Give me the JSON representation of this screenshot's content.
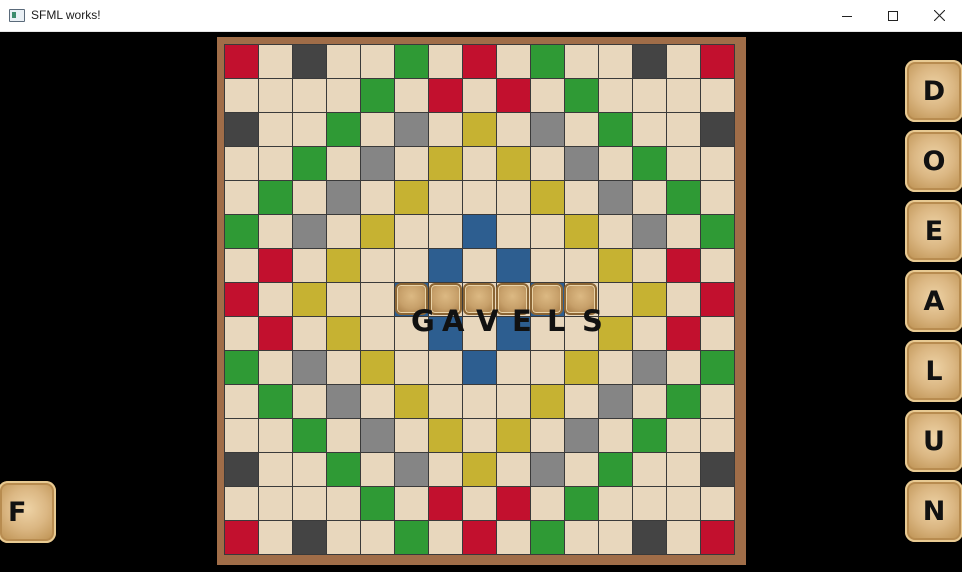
{
  "window": {
    "title": "SFML works!",
    "buttons": [
      "minimize",
      "maximize",
      "close"
    ]
  },
  "board": {
    "size": 15,
    "colors": {
      "normal": "#e8d7bd",
      "red": "#c2102e",
      "green": "#2f9a35",
      "yellow": "#c6b232",
      "gray": "#858585",
      "dark": "#444444",
      "blue": "#2d5e90",
      "frame": "#a06d48"
    },
    "layout": [
      "r..d..g.r.g..d.r",
      ".....g.r.r.g....",
      "d...g..a.y.a..g.d",
      "",
      "",
      "",
      "",
      "",
      "",
      "",
      "",
      "",
      "",
      "",
      ""
    ],
    "rows": [
      "r . d . . g . r . g . . d . r",
      ". . . . g . r . r . g . . . .",
      "d . . g . a . y . a . g . . d",
      ". . g . a . y . y . a . g . .",
      ". g . a . y . . . y . a . g .",
      "g . a . y . . b . . y . a . g",
      ". r . y . . b . b . . y . r .",
      "r . y . . b . . . b . . y . r",
      ". r . y . . b . b . . y . r .",
      "g . a . y . . b . . y . a . g",
      ". g . a . y . . . y . a . g .",
      ". . g . a . y . y . a . g . .",
      "d . . g . a . y . a . g . . d",
      ". . . . g . r . r . g . . . .",
      "r . d . . g . r . g . . d . r"
    ],
    "placed_word": "GAVELS",
    "placed_letters": [
      "G",
      "A",
      "V",
      "E",
      "L",
      "S"
    ],
    "placed_row": 8,
    "placed_start_col": 6
  },
  "rack_right": [
    "D",
    "O",
    "E",
    "A",
    "L",
    "U",
    "N"
  ],
  "rack_left": [
    "F"
  ]
}
